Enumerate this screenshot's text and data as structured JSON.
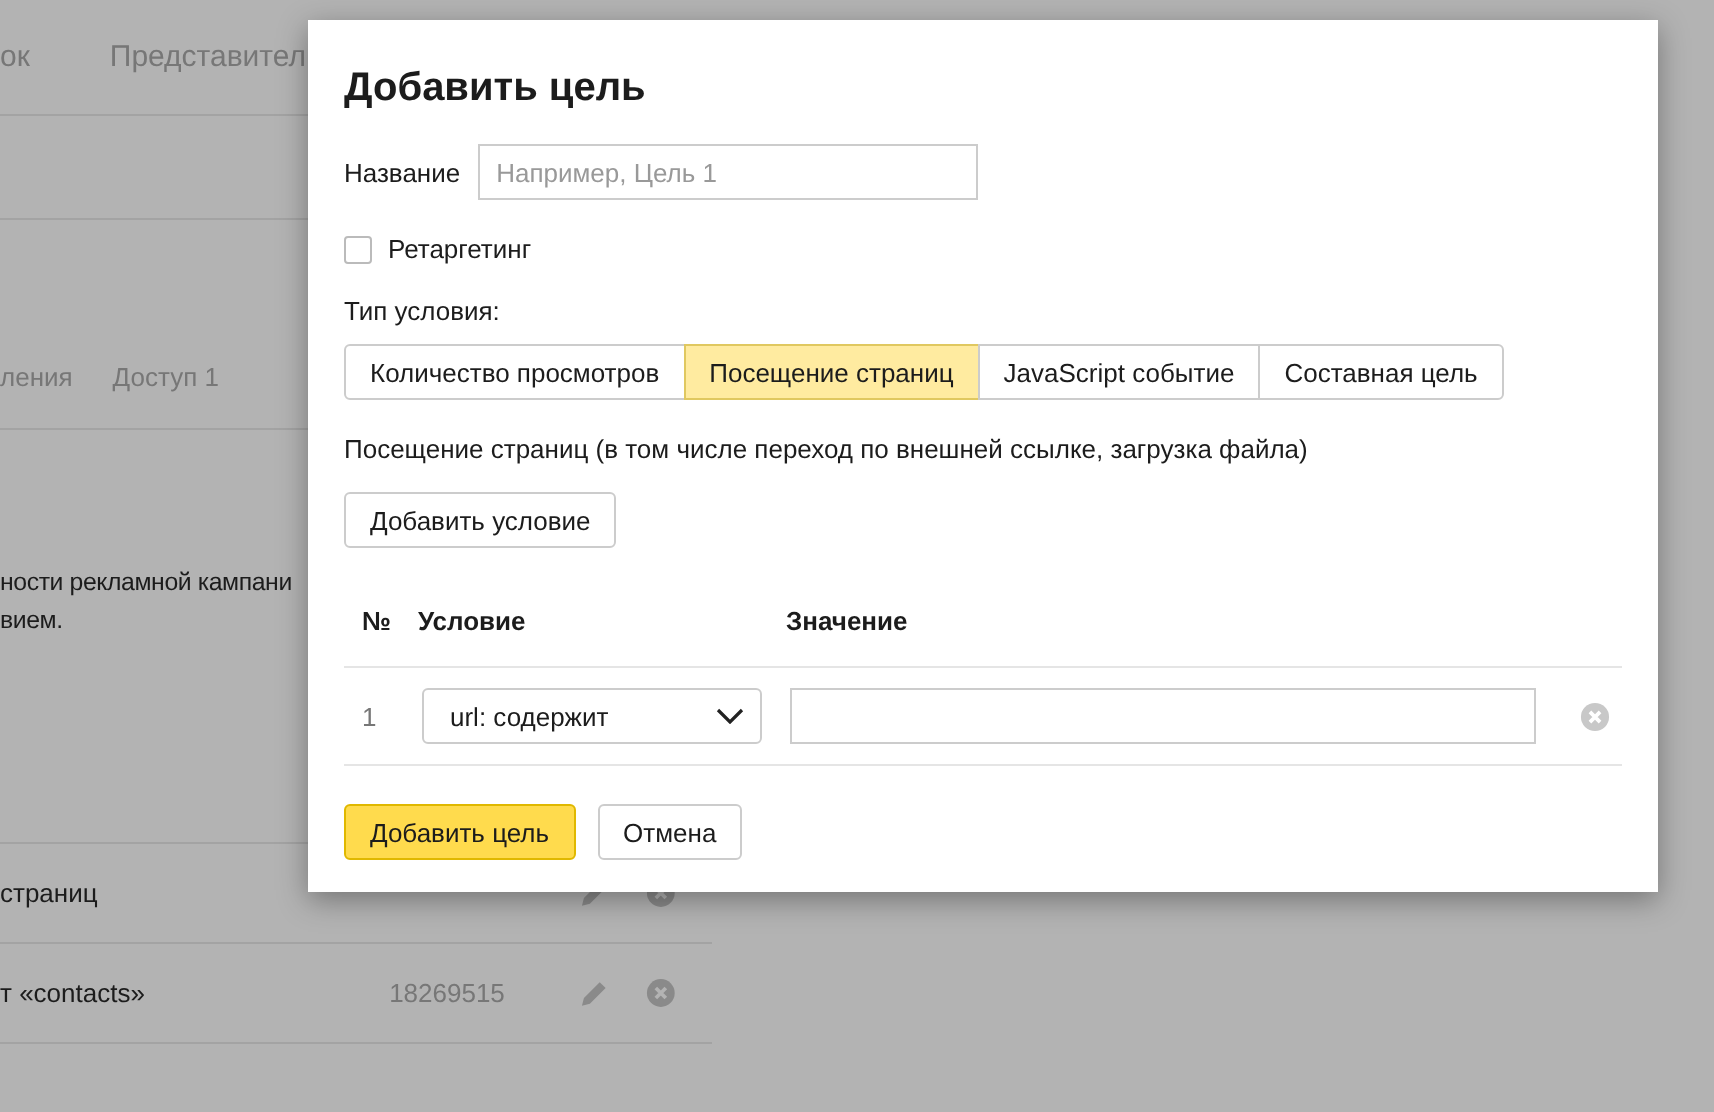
{
  "background": {
    "nav": [
      "ок",
      "Представител"
    ],
    "tabs": [
      "ления",
      "Доступ 1"
    ],
    "paragraph_lines": [
      "ности рекламной кампани",
      "вием."
    ],
    "goals": [
      {
        "name": "страниц"
      },
      {
        "name": "т «contacts»",
        "id": "18269515"
      }
    ]
  },
  "dialog": {
    "title": "Добавить цель",
    "name_label": "Название",
    "name_placeholder": "Например, Цель 1",
    "retargeting": {
      "label": "Ретаргетинг",
      "checked": false
    },
    "type_label": "Тип условия:",
    "types": [
      {
        "label": "Количество просмотров",
        "selected": false
      },
      {
        "label": "Посещение страниц",
        "selected": true
      },
      {
        "label": "JavaScript событие",
        "selected": false
      },
      {
        "label": "Составная цель",
        "selected": false
      }
    ],
    "type_description": "Посещение страниц (в том числе переход по внешней ссылке, загрузка файла)",
    "add_condition": "Добавить условие",
    "columns": [
      "№",
      "Условие",
      "Значение"
    ],
    "conditions": [
      {
        "number": "1",
        "condition": "url: содержит"
      }
    ],
    "buttons": [
      {
        "label": "Добавить цель",
        "kind": "primary"
      },
      {
        "label": "Отмена",
        "kind": "default"
      }
    ]
  }
}
